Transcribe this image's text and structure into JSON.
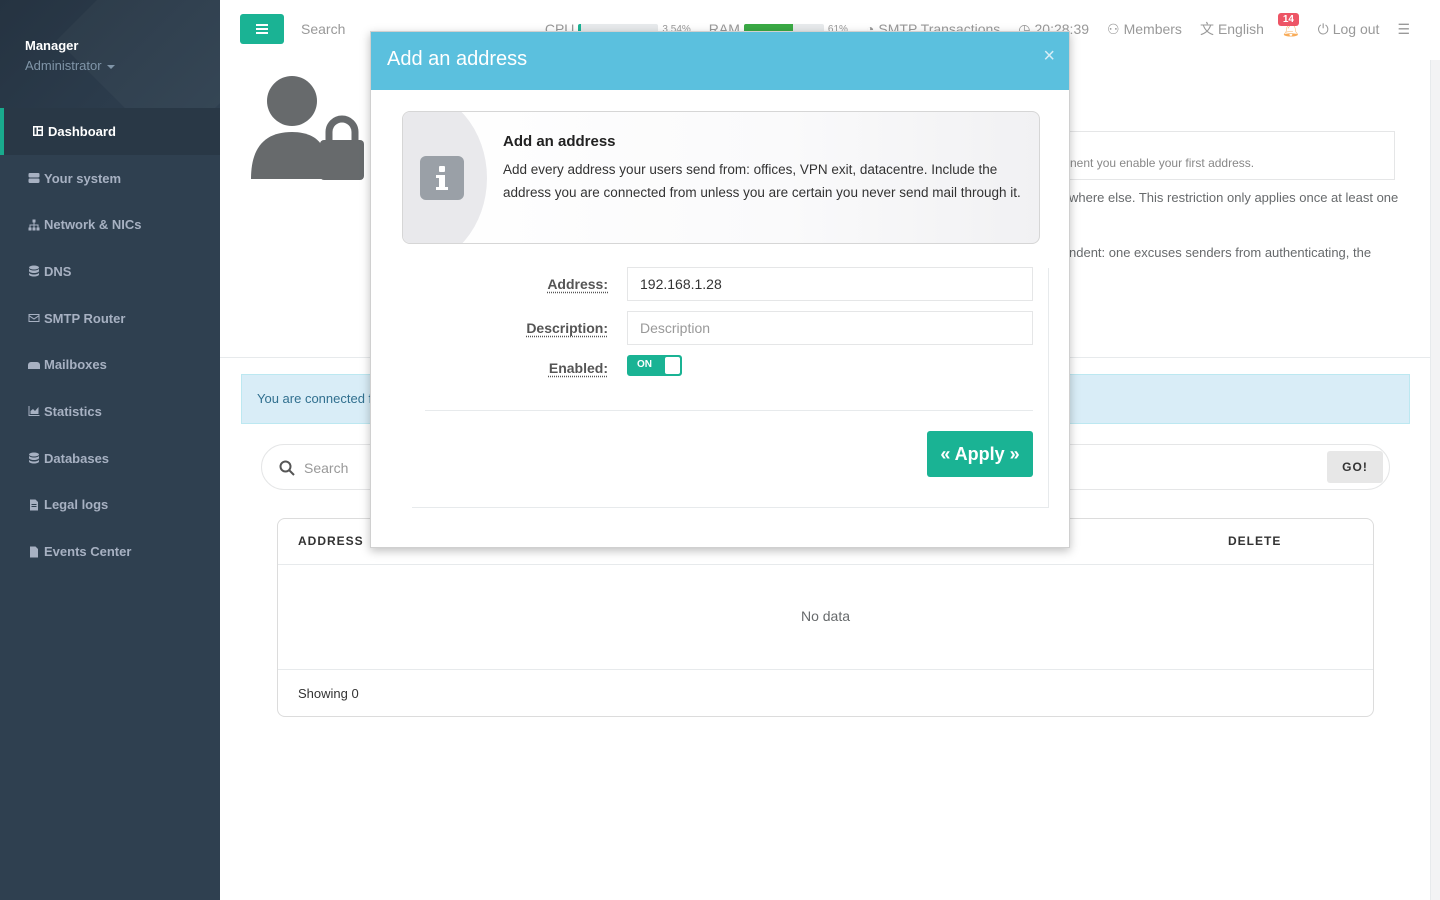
{
  "sidebar": {
    "profile": {
      "name": "Manager",
      "role": "Administrator"
    },
    "items": [
      {
        "label": "Dashboard",
        "icon": "dashboard-icon",
        "active": true
      },
      {
        "label": "Your system",
        "icon": "server-icon"
      },
      {
        "label": "Network & NICs",
        "icon": "network-icon"
      },
      {
        "label": "DNS",
        "icon": "database-icon"
      },
      {
        "label": "SMTP Router",
        "icon": "envelope-icon"
      },
      {
        "label": "Mailboxes",
        "icon": "mailbox-icon"
      },
      {
        "label": "Statistics",
        "icon": "chart-icon"
      },
      {
        "label": "Databases",
        "icon": "database-icon"
      },
      {
        "label": "Legal logs",
        "icon": "file-icon"
      },
      {
        "label": "Events Center",
        "icon": "file-icon"
      }
    ]
  },
  "topbar": {
    "search_placeholder": "Search",
    "cpu_label": "CPU",
    "cpu_value": "3.54%",
    "cpu_fraction": 0.035,
    "ram_label": "RAM",
    "ram_value": "61%",
    "ram_fraction": 0.61,
    "smtp_label": "SMTP Transactions",
    "clock": "20:28:39",
    "members_label": "Members",
    "language": "English",
    "notifications_count": "14",
    "logout_label": "Log out"
  },
  "background": {
    "info_box_text": "nent you enable your first address.",
    "text_line1": "where else. This restriction only applies once at least one",
    "text_line2": "ndent: one excuses senders from authenticating, the",
    "alert_text": "You are connected fr",
    "search_placeholder": "Search",
    "go_label": "GO!",
    "table": {
      "col_address": "ADDRESS",
      "col_delete": "DELETE",
      "empty_text": "No data",
      "footer": "Showing 0"
    }
  },
  "modal": {
    "title": "Add an address",
    "close_symbol": "×",
    "intro_title": "Add an address",
    "intro_text": "Add every address your users send from: offices, VPN exit, datacentre. Include the address you are connected from unless you are certain you never send mail through it.",
    "fields": {
      "address_label": "Address:",
      "address_value": "192.168.1.28",
      "description_label": "Description:",
      "description_placeholder": "Description",
      "enabled_label": "Enabled:",
      "enabled_state": "ON"
    },
    "apply_label": "« Apply »"
  },
  "colors": {
    "sidebar_bg": "#2f4050",
    "accent": "#1ab394",
    "modal_header": "#5bc0de",
    "badge": "#ed5565"
  }
}
